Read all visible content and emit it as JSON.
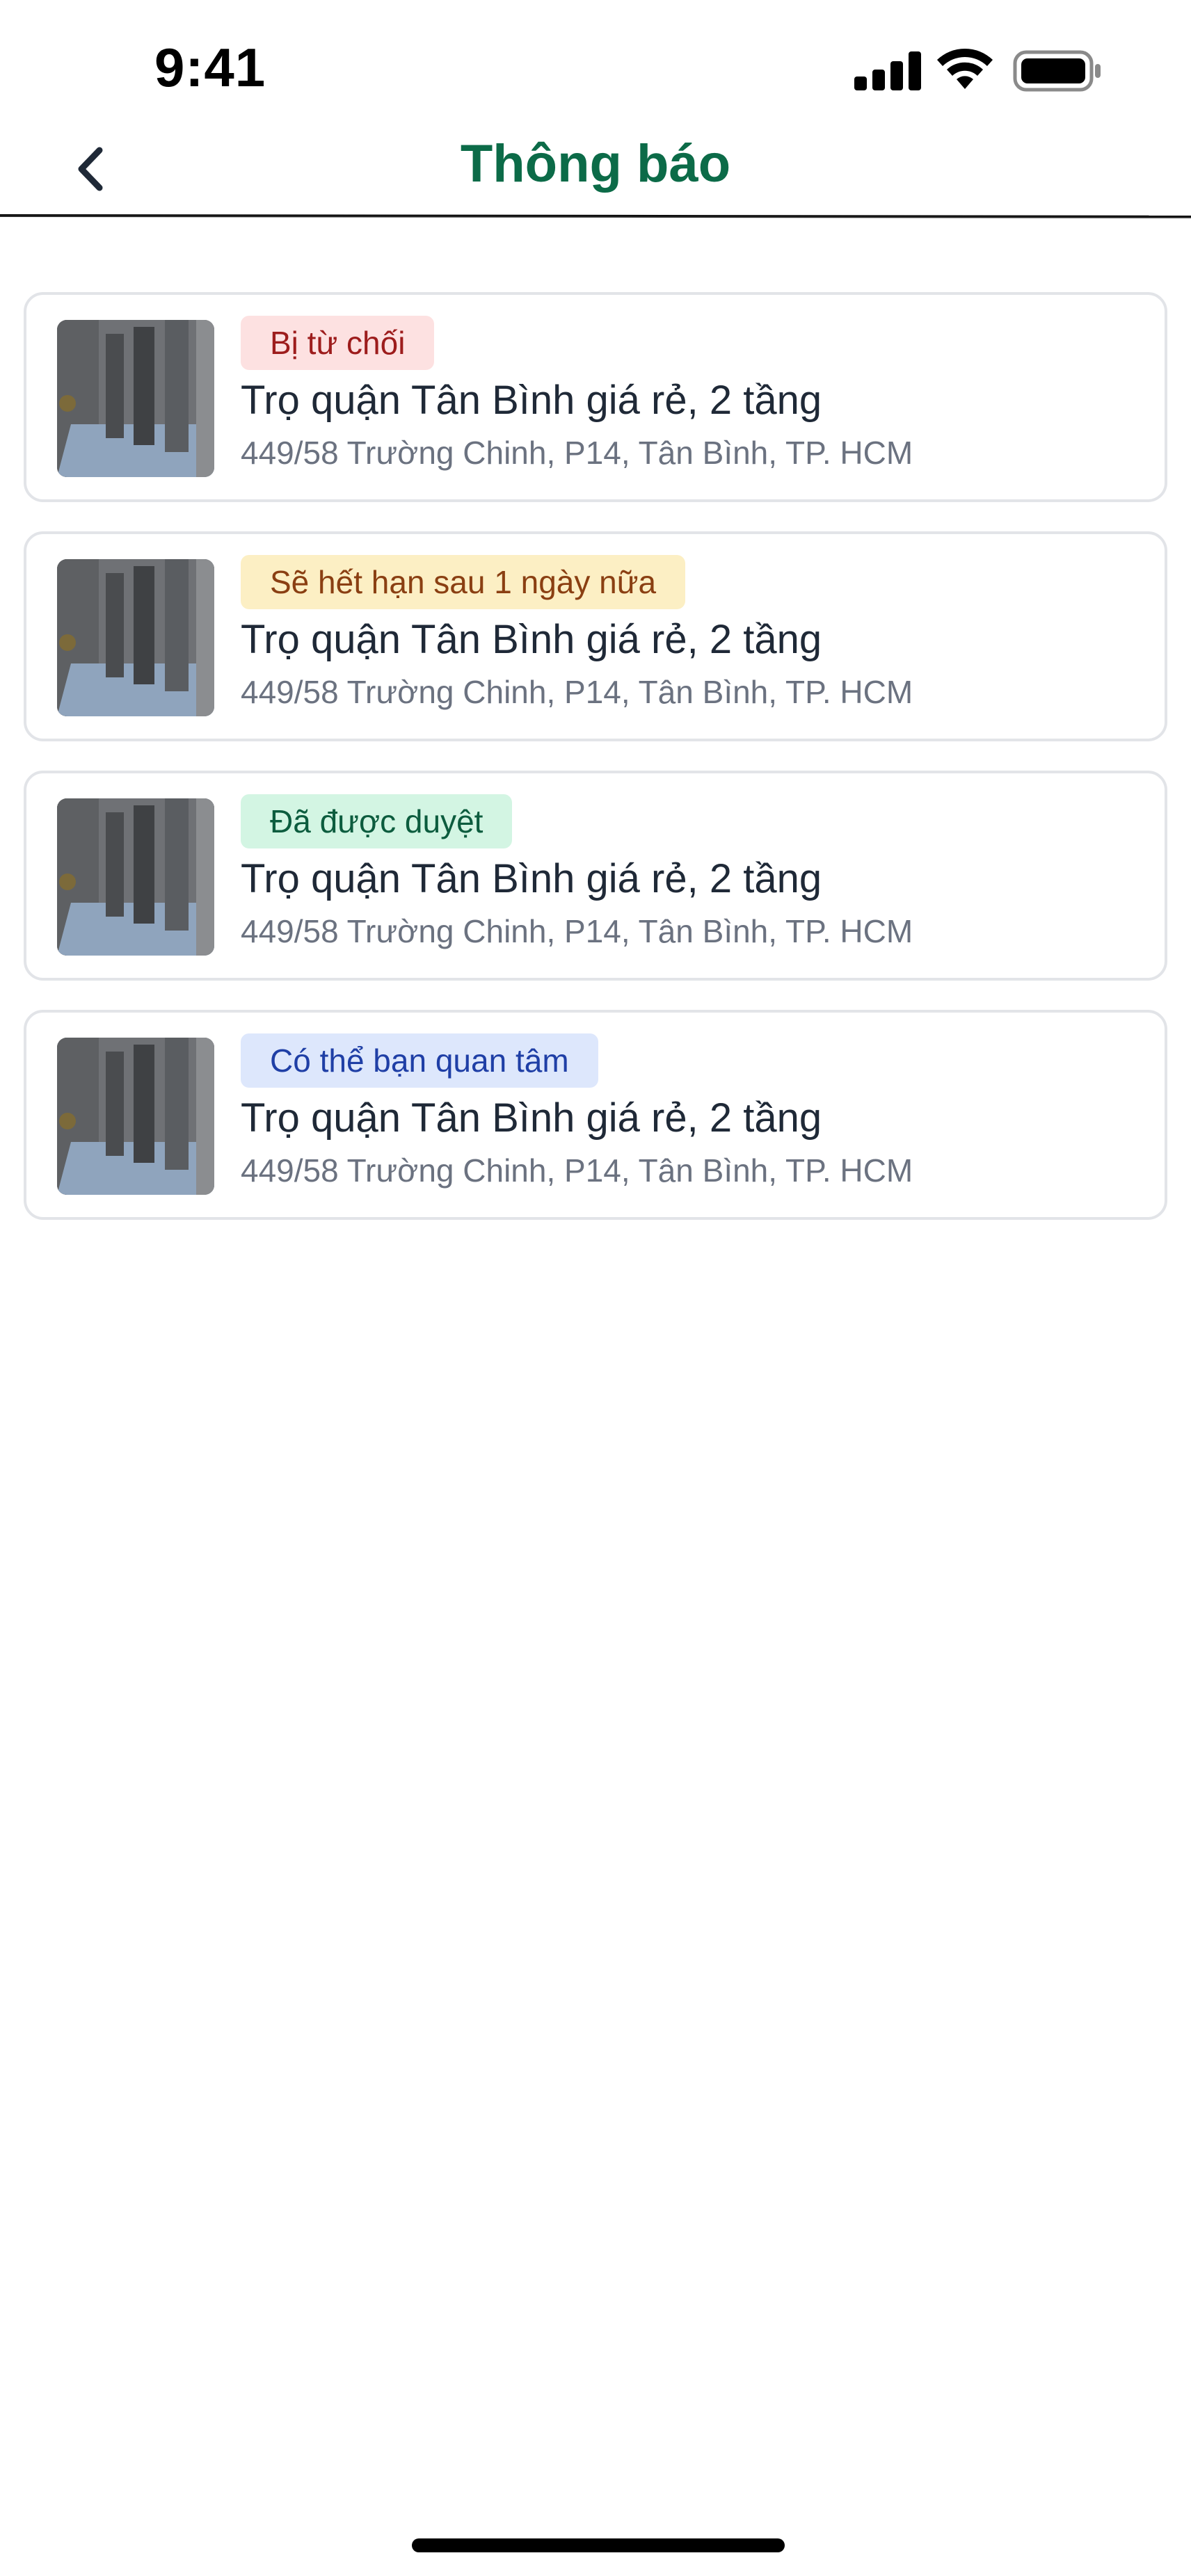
{
  "status_bar": {
    "time": "9:41",
    "icons": [
      "signal-icon",
      "wifi-icon",
      "battery-icon"
    ]
  },
  "header": {
    "title": "Thông báo",
    "back_icon": "chevron-left-icon",
    "title_color": "#0c6b48"
  },
  "notifications": [
    {
      "badge": "Bị từ chối",
      "badge_style": "red",
      "title": "Trọ quận Tân Bình giá rẻ, 2 tầng",
      "address": "449/58 Trường Chinh, P14, Tân Bình, TP. HCM"
    },
    {
      "badge": "Sẽ hết hạn sau 1 ngày nữa",
      "badge_style": "yellow",
      "title": "Trọ quận Tân Bình giá rẻ, 2 tầng",
      "address": "449/58 Trường Chinh, P14, Tân Bình, TP. HCM"
    },
    {
      "badge": "Đã được duyệt",
      "badge_style": "green",
      "title": "Trọ quận Tân Bình giá rẻ, 2 tầng",
      "address": "449/58 Trường Chinh, P14, Tân Bình, TP. HCM"
    },
    {
      "badge": "Có thể bạn quan tâm",
      "badge_style": "blue",
      "title": "Trọ quận Tân Bình giá rẻ, 2 tầng",
      "address": "449/58 Trường Chinh, P14, Tân Bình, TP. HCM"
    }
  ],
  "colors": {
    "badge_red_bg": "#fde1e1",
    "badge_yellow_bg": "#fcefc4",
    "badge_green_bg": "#d3f5e3",
    "badge_blue_bg": "#dde7fc"
  }
}
